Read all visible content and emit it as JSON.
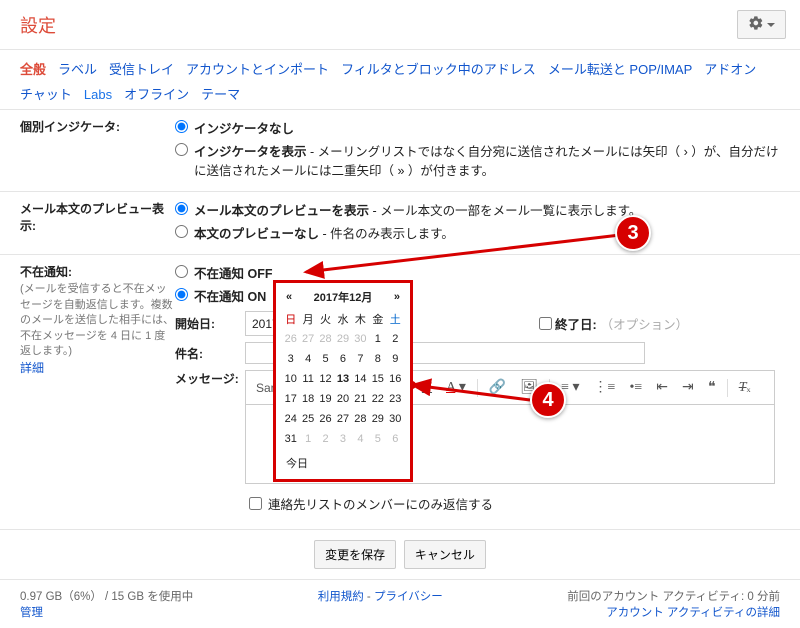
{
  "header": {
    "title": "設定"
  },
  "tabs_1": [
    "全般",
    "ラベル",
    "受信トレイ",
    "アカウントとインポート",
    "フィルタとブロック中のアドレス",
    "メール転送と POP/IMAP",
    "アドオン"
  ],
  "tabs_2": [
    "チャット",
    "Labs",
    "オフライン",
    "テーマ"
  ],
  "active_tab": "全般",
  "indicators": {
    "title": "個別インジケータ:",
    "none": "インジケータなし",
    "show_label": "インジケータを表示",
    "show_desc": " - メーリングリストではなく自分宛に送信されたメールには矢印（ › ）が、自分だけに送信されたメールには二重矢印（ » ）が付きます。"
  },
  "preview": {
    "title": "メール本文のプレビュー表示:",
    "show_label": "メール本文のプレビューを表示",
    "show_desc": " - メール本文の一部をメール一覧に表示します。",
    "none_label": "本文のプレビューなし",
    "none_desc": " - 件名のみ表示します。"
  },
  "vacation": {
    "title": "不在通知:",
    "sub": "(メールを受信すると不在メッセージを自動返信します。複数のメールを送信した相手には、不在メッセージを 4 日に 1 度返します。)",
    "detail_link": "詳細",
    "off": "不在通知 OFF",
    "on": "不在通知 ON",
    "start_label": "開始日:",
    "start_value": "2017年12月13日",
    "end_label": "終了日:",
    "end_placeholder": "（オプション）",
    "subject_label": "件名:",
    "message_label": "メッセージ:",
    "contacts_only": "連絡先リストのメンバーにのみ返信する"
  },
  "calendar": {
    "month_label": "2017年12月",
    "prev": "«",
    "next": "»",
    "dow": [
      "日",
      "月",
      "火",
      "水",
      "木",
      "金",
      "土"
    ],
    "rows": [
      [
        {
          "d": 26,
          "dim": true
        },
        {
          "d": 27,
          "dim": true
        },
        {
          "d": 28,
          "dim": true
        },
        {
          "d": 29,
          "dim": true
        },
        {
          "d": 30,
          "dim": true
        },
        {
          "d": 1
        },
        {
          "d": 2
        }
      ],
      [
        {
          "d": 3
        },
        {
          "d": 4
        },
        {
          "d": 5
        },
        {
          "d": 6
        },
        {
          "d": 7
        },
        {
          "d": 8
        },
        {
          "d": 9
        }
      ],
      [
        {
          "d": 10
        },
        {
          "d": 11
        },
        {
          "d": 12
        },
        {
          "d": 13,
          "today": true
        },
        {
          "d": 14
        },
        {
          "d": 15
        },
        {
          "d": 16
        }
      ],
      [
        {
          "d": 17
        },
        {
          "d": 18
        },
        {
          "d": 19
        },
        {
          "d": 20
        },
        {
          "d": 21
        },
        {
          "d": 22
        },
        {
          "d": 23
        }
      ],
      [
        {
          "d": 24
        },
        {
          "d": 25
        },
        {
          "d": 26
        },
        {
          "d": 27
        },
        {
          "d": 28
        },
        {
          "d": 29
        },
        {
          "d": 30
        }
      ],
      [
        {
          "d": 31
        },
        {
          "d": 1,
          "dim": true
        },
        {
          "d": 2,
          "dim": true
        },
        {
          "d": 3,
          "dim": true
        },
        {
          "d": 4,
          "dim": true
        },
        {
          "d": 5,
          "dim": true
        },
        {
          "d": 6,
          "dim": true
        }
      ]
    ],
    "today": "今日"
  },
  "toolbar": {
    "font": "Sans Serif"
  },
  "actions": {
    "save": "変更を保存",
    "cancel": "キャンセル"
  },
  "footer": {
    "storage": "0.97 GB（6%） / 15 GB を使用中",
    "manage": "管理",
    "terms": "利用規約",
    "privacy": "プライバシー",
    "activity1": "前回のアカウント アクティビティ: 0 分前",
    "activity2": "アカウント アクティビティの詳細"
  },
  "callouts": {
    "b1": "3",
    "b2": "4"
  }
}
